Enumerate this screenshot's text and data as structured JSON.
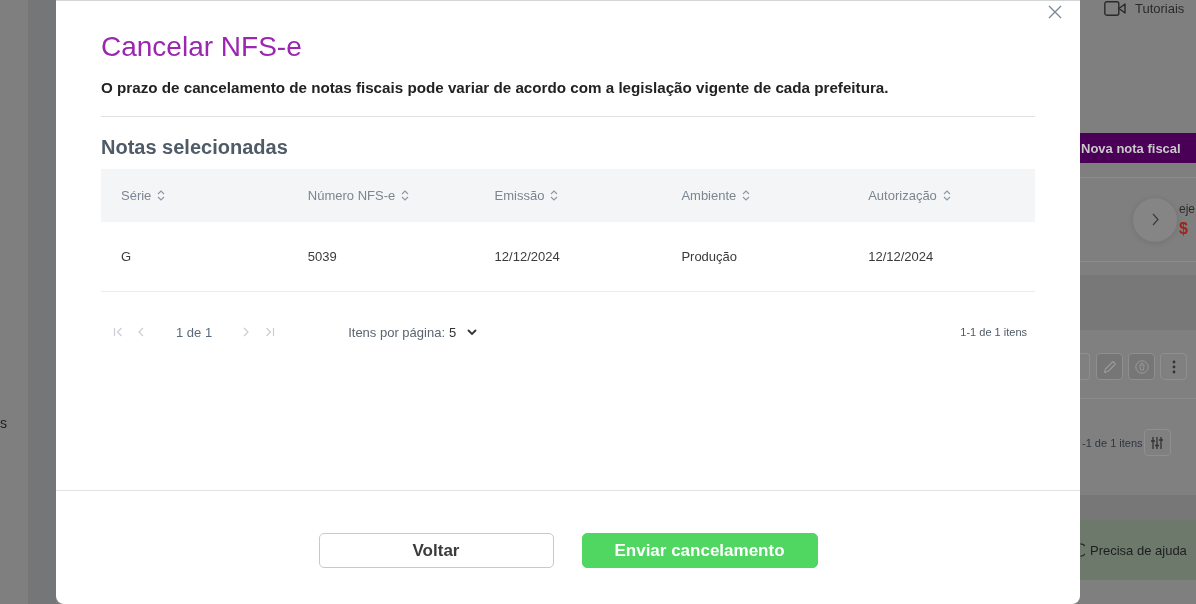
{
  "background": {
    "left_sidebar_text": "s",
    "top_link": "Tutoriais",
    "new_button": "Nova nota fiscal",
    "card": {
      "label": "eje",
      "amount": "$"
    },
    "actions": [
      {
        "kind": "partial"
      },
      {
        "kind": "edit",
        "disabled": true
      },
      {
        "kind": "delete",
        "disabled": true
      },
      {
        "kind": "more",
        "disabled": false
      }
    ],
    "count": "-1 de 1 itens",
    "help": "Precisa de ajuda"
  },
  "modal": {
    "title": "Cancelar NFS-e",
    "notice": "O prazo de cancelamento de notas fiscais pode variar de acordo com a legislação vigente de cada prefeitura.",
    "section_title": "Notas selecionadas",
    "table": {
      "columns": [
        "Série",
        "Número NFS-e",
        "Emissão",
        "Ambiente",
        "Autorização"
      ],
      "rows": [
        [
          "G",
          "5039",
          "12/12/2024",
          "Produção",
          "12/12/2024"
        ]
      ]
    },
    "pagination": {
      "nav": [
        {
          "kind": "first",
          "disabled": true
        },
        {
          "kind": "previous",
          "disabled": true
        },
        {
          "kind": "next",
          "disabled": true
        },
        {
          "kind": "last",
          "disabled": true
        }
      ],
      "page": "1 de 1",
      "per_page_label": "Itens por página:",
      "per_page_value": "5",
      "range": "1-1 de 1 itens"
    },
    "buttons": [
      {
        "kind": "secondary",
        "label": "Voltar"
      },
      {
        "kind": "primary",
        "label": "Enviar cancelamento"
      }
    ]
  }
}
